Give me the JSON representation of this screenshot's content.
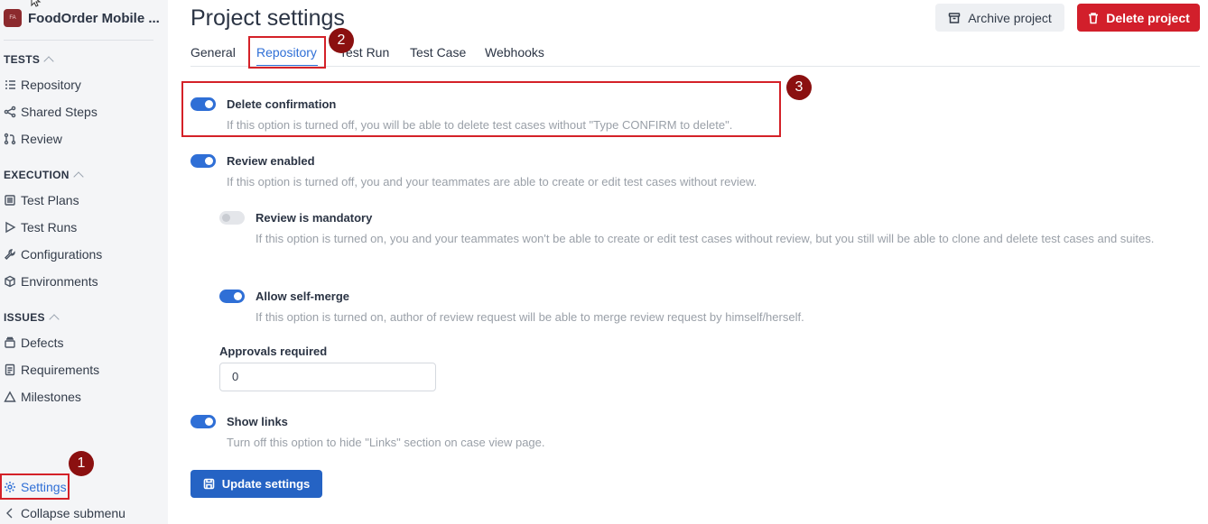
{
  "sidebar": {
    "project_initials": "FA",
    "project_name": "FoodOrder Mobile ...",
    "sections": {
      "tests": "TESTS",
      "execution": "EXECUTION",
      "issues": "ISSUES"
    },
    "items": {
      "repository": "Repository",
      "shared_steps": "Shared Steps",
      "review": "Review",
      "test_plans": "Test Plans",
      "test_runs": "Test Runs",
      "configurations": "Configurations",
      "environments": "Environments",
      "defects": "Defects",
      "requirements": "Requirements",
      "milestones": "Milestones",
      "settings": "Settings",
      "collapse": "Collapse submenu"
    }
  },
  "header": {
    "title": "Project settings",
    "archive_label": "Archive project",
    "delete_label": "Delete project"
  },
  "tabs": [
    "General",
    "Repository",
    "Test Run",
    "Test Case",
    "Webhooks"
  ],
  "active_tab": "Repository",
  "options": {
    "delete_confirmation": {
      "label": "Delete confirmation",
      "enabled": true,
      "description": "If this option is turned off, you will be able to delete test cases without \"Type CONFIRM to delete\"."
    },
    "review_enabled": {
      "label": "Review enabled",
      "enabled": true,
      "description": "If this option is turned off, you and your teammates are able to create or edit test cases without review."
    },
    "review_mandatory": {
      "label": "Review is mandatory",
      "enabled": false,
      "description": "If this option is turned on, you and your teammates won't be able to create or edit test cases without review, but you still will be able to clone and delete test cases and suites."
    },
    "allow_self_merge": {
      "label": "Allow self-merge",
      "enabled": true,
      "description": "If this option is turned on, author of review request will be able to merge review request by himself/herself."
    },
    "show_links": {
      "label": "Show links",
      "enabled": true,
      "description": "Turn off this option to hide \"Links\" section on case view page."
    }
  },
  "approvals": {
    "label": "Approvals required",
    "value": "0"
  },
  "update_label": "Update settings",
  "annotations": [
    "1",
    "2",
    "3"
  ],
  "colors": {
    "accent": "#2f6fd6",
    "danger": "#d21f2b",
    "highlight": "#d42128",
    "badge": "#8b1010"
  }
}
